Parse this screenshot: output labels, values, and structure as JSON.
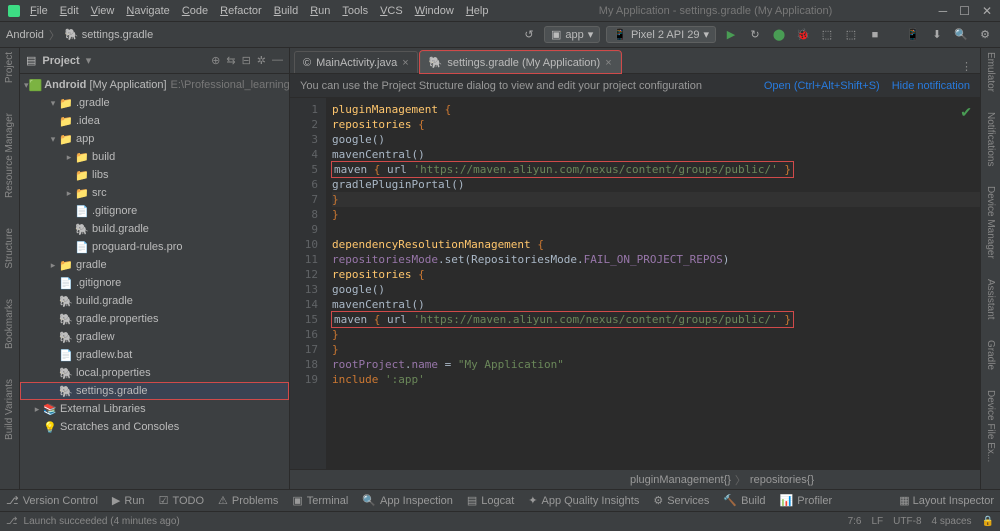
{
  "menu": [
    "File",
    "Edit",
    "View",
    "Navigate",
    "Code",
    "Refactor",
    "Build",
    "Run",
    "Tools",
    "VCS",
    "Window",
    "Help"
  ],
  "app_title": "My Application - settings.gradle (My Application)",
  "breadcrumb": [
    "Android",
    "settings.gradle"
  ],
  "run_config": {
    "module": "app",
    "device": "Pixel 2 API 29"
  },
  "left_tools": [
    "Project",
    "Resource Manager",
    "Structure",
    "Bookmarks",
    "Build Variants"
  ],
  "right_tools": [
    "Emulator",
    "Notifications",
    "Device Manager",
    "Assistant",
    "Gradle",
    "Device File Ex..."
  ],
  "project_panel": {
    "title": "Project",
    "root": {
      "label": "Android",
      "extra": "[My Application]",
      "path": "E:\\Professional_learning\\Andr"
    },
    "items": [
      {
        "indent": 1,
        "arrow": "▾",
        "ic": "📁",
        "cls": "folder",
        "label": ".gradle"
      },
      {
        "indent": 1,
        "arrow": "",
        "ic": "📁",
        "cls": "folder",
        "label": ".idea"
      },
      {
        "indent": 1,
        "arrow": "▾",
        "ic": "📁",
        "cls": "folder green",
        "label": "app"
      },
      {
        "indent": 2,
        "arrow": "▸",
        "ic": "📁",
        "cls": "folder",
        "label": "build"
      },
      {
        "indent": 2,
        "arrow": "",
        "ic": "📁",
        "cls": "folder",
        "label": "libs"
      },
      {
        "indent": 2,
        "arrow": "▸",
        "ic": "📁",
        "cls": "folder",
        "label": "src"
      },
      {
        "indent": 2,
        "arrow": "",
        "ic": "📄",
        "cls": "",
        "label": ".gitignore"
      },
      {
        "indent": 2,
        "arrow": "",
        "ic": "🐘",
        "cls": "gfile",
        "label": "build.gradle"
      },
      {
        "indent": 2,
        "arrow": "",
        "ic": "📄",
        "cls": "",
        "label": "proguard-rules.pro"
      },
      {
        "indent": 1,
        "arrow": "▸",
        "ic": "📁",
        "cls": "folder",
        "label": "gradle"
      },
      {
        "indent": 1,
        "arrow": "",
        "ic": "📄",
        "cls": "",
        "label": ".gitignore"
      },
      {
        "indent": 1,
        "arrow": "",
        "ic": "🐘",
        "cls": "gfile",
        "label": "build.gradle"
      },
      {
        "indent": 1,
        "arrow": "",
        "ic": "🐘",
        "cls": "gfile",
        "label": "gradle.properties"
      },
      {
        "indent": 1,
        "arrow": "",
        "ic": "🐘",
        "cls": "gfile",
        "label": "gradlew"
      },
      {
        "indent": 1,
        "arrow": "",
        "ic": "📄",
        "cls": "",
        "label": "gradlew.bat"
      },
      {
        "indent": 1,
        "arrow": "",
        "ic": "🐘",
        "cls": "gfile",
        "label": "local.properties"
      },
      {
        "indent": 1,
        "arrow": "",
        "ic": "🐘",
        "cls": "gfile",
        "label": "settings.gradle",
        "selected": true
      },
      {
        "indent": 0,
        "arrow": "▸",
        "ic": "📚",
        "cls": "",
        "label": "External Libraries"
      },
      {
        "indent": 0,
        "arrow": "",
        "ic": "💡",
        "cls": "",
        "label": "Scratches and Consoles"
      }
    ]
  },
  "tabs": [
    {
      "icon": "©",
      "label": "MainActivity.java",
      "active": false
    },
    {
      "icon": "🐘",
      "label": "settings.gradle (My Application)",
      "active": true
    }
  ],
  "hint": {
    "text": "You can use the Project Structure dialog to view and edit your project configuration",
    "link1": "Open (Ctrl+Alt+Shift+S)",
    "link2": "Hide notification"
  },
  "code": {
    "lines": 19,
    "maven_url": "'https://maven.aliyun.com/nexus/content/groups/public/'",
    "app_name": "\"My Application\"",
    "incl": "':app'"
  },
  "code_crumb": [
    "pluginManagement{}",
    "repositories{}"
  ],
  "bottom_tools": [
    "Version Control",
    "Run",
    "TODO",
    "Problems",
    "Terminal",
    "App Inspection",
    "Logcat",
    "App Quality Insights",
    "Services",
    "Build",
    "Profiler"
  ],
  "bottom_right": "Layout Inspector",
  "status": {
    "left": "Launch succeeded (4 minutes ago)",
    "pos": "7:6",
    "le": "LF",
    "enc": "UTF-8",
    "ind": "4 spaces"
  }
}
